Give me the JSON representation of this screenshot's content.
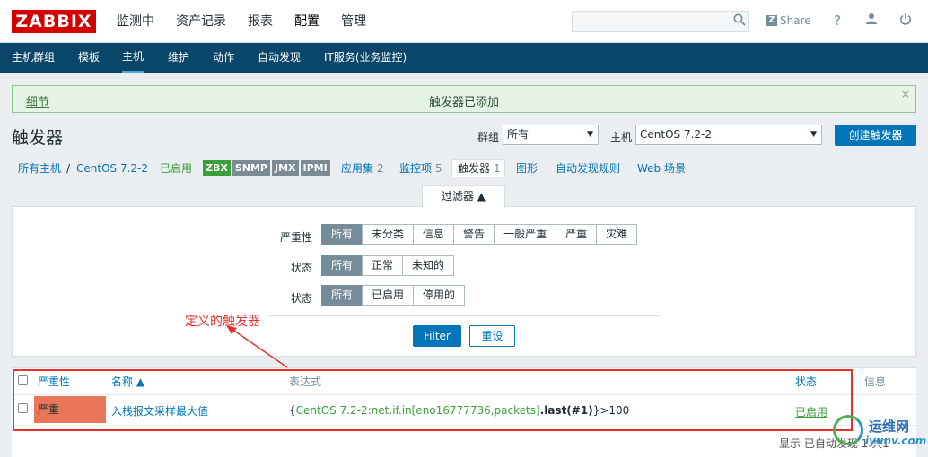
{
  "brand": {
    "logo": "ZABBIX"
  },
  "main_menu": [
    "监测中",
    "资产记录",
    "报表",
    "配置",
    "管理"
  ],
  "topbar": {
    "share_label": "Share",
    "help": "?"
  },
  "sub_menu": [
    "主机群组",
    "模板",
    "主机",
    "维护",
    "动作",
    "自动发现",
    "IT服务(业务监控)"
  ],
  "message": {
    "details": "细节",
    "text": "触发器已添加",
    "close": "×"
  },
  "page": {
    "title": "触发器",
    "create_button": "创建触发器"
  },
  "filters_top": {
    "group_label": "群组",
    "group_value": "所有",
    "host_label": "主机",
    "host_value": "CentOS 7.2-2"
  },
  "host_nav": {
    "all_hosts": "所有主机",
    "separator": "/",
    "host": "CentOS 7.2-2",
    "status": "已启用",
    "tags": [
      "ZBX",
      "SNMP",
      "JMX",
      "IPMI"
    ],
    "apps_label": "应用集",
    "apps_count": "2",
    "items_label": "监控项",
    "items_count": "5",
    "triggers_label": "触发器",
    "triggers_count": "1",
    "graphs_label": "图形",
    "discovery_label": "自动发现规则",
    "web_label": "Web 场景"
  },
  "filter": {
    "tab_label": "过滤器 ▲",
    "severity_label": "严重性",
    "severity_options": [
      "所有",
      "未分类",
      "信息",
      "警告",
      "一般严重",
      "严重",
      "灾难"
    ],
    "state_label": "状态",
    "state_options": [
      "所有",
      "正常",
      "未知的"
    ],
    "status_label": "状态",
    "status_options": [
      "所有",
      "已启用",
      "停用的"
    ],
    "filter_button": "Filter",
    "reset_button": "重设"
  },
  "annotation": "定义的触发器",
  "table": {
    "headers": {
      "severity": "严重性",
      "name": "名称 ▲",
      "expression": "表达式",
      "status": "状态",
      "info": "信息"
    },
    "rows": [
      {
        "severity": "严重",
        "name": "入栈报文采样最大值",
        "expr_open": "{",
        "expr_key": "CentOS 7.2-2:net.if.in[eno16777736,packets]",
        "expr_func": ".last(#1)",
        "expr_close": "}>100",
        "status": "已启用"
      }
    ]
  },
  "footer": "显示 已自动发现 1 共1",
  "watermark": {
    "line1": "运维网",
    "line2": "iyunv.com"
  },
  "colors": {
    "brand_red": "#d40000",
    "nav_blue": "#0a466a",
    "accent": "#0275b8",
    "severity_high": "#e97659",
    "enabled_green": "#3a9f3a",
    "annotation_red": "#e2312f"
  }
}
